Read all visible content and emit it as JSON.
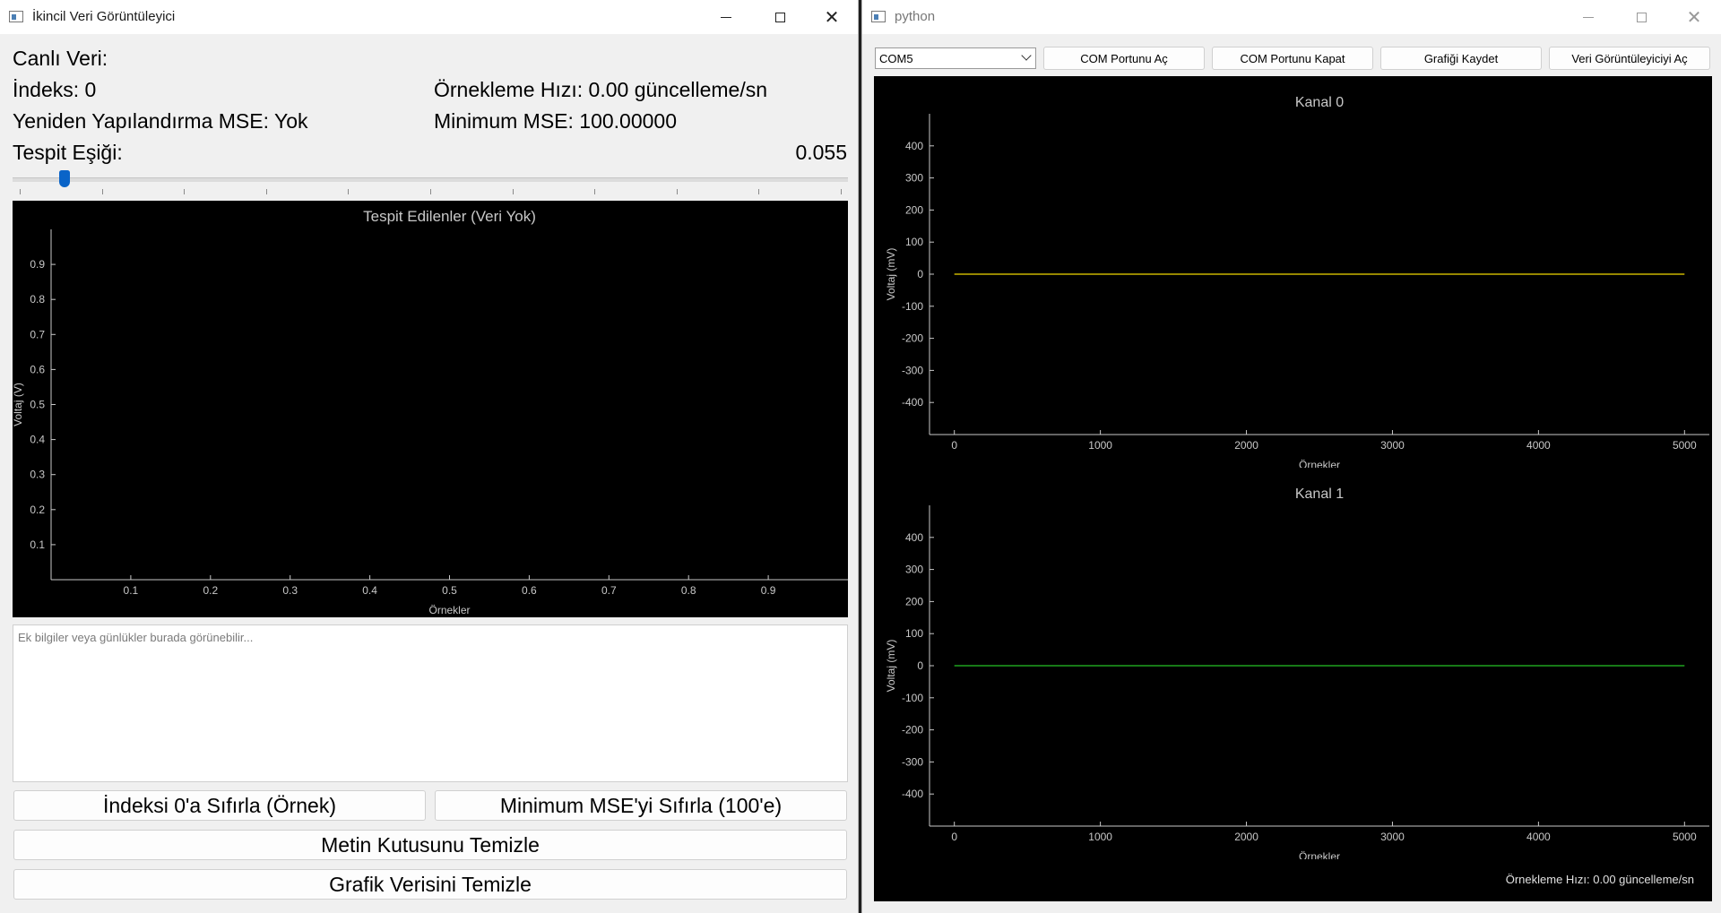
{
  "detection_window": {
    "title": "İkincil Veri Görüntüleyici",
    "live_data_label": "Canlı Veri:",
    "index_label": "İndeks: 0",
    "sampling_rate_label": "Örnekleme Hızı: 0.00 güncelleme/sn",
    "reconstruction_mse_label": "Yeniden Yapılandırma MSE: Yok",
    "minimum_mse_label": "Minimum MSE: 100.00000",
    "threshold_label": "Tespit Eşiği:",
    "threshold_value": "0.055",
    "threshold_slider": {
      "min": 0,
      "max": 1,
      "value": 0.055
    },
    "log_placeholder": "Ek bilgiler veya günlükler burada görünebilir...",
    "buttons": {
      "reset_index": "İndeksi 0'a Sıfırla (Örnek)",
      "reset_min_mse": "Minimum MSE'yi Sıfırla (100'e)",
      "clear_textbox": "Metin Kutusunu Temizle",
      "clear_plot": "Grafik Verisini Temizle"
    }
  },
  "serial_window": {
    "title": "python",
    "port_select": {
      "selected": "COM5"
    },
    "buttons": {
      "open_port": "COM Portunu Aç",
      "close_port": "COM Portunu Kapat",
      "save_plot": "Grafiği Kaydet",
      "open_viewer": "Veri Görüntüleyiciyi Aç"
    },
    "status": "Örnekleme Hızı: 0.00 güncelleme/sn"
  },
  "colors": {
    "plot_bg": "#000000",
    "axis": "#c8c8c8",
    "channel0_line": "#c8b400",
    "channel1_line": "#1fa31f",
    "slider_handle": "#0a64c8"
  },
  "chart_data": [
    {
      "id": "detected",
      "type": "line",
      "title": "Tespit Edilenler (Veri Yok)",
      "xlabel": "Örnekler",
      "ylabel": "Voltaj (V)",
      "xlim": [
        0,
        1
      ],
      "ylim": [
        0,
        1
      ],
      "x_ticks": [
        "0.1",
        "0.2",
        "0.3",
        "0.4",
        "0.5",
        "0.6",
        "0.7",
        "0.8",
        "0.9"
      ],
      "y_ticks": [
        "0.1",
        "0.2",
        "0.3",
        "0.4",
        "0.5",
        "0.6",
        "0.7",
        "0.8",
        "0.9"
      ],
      "series": []
    },
    {
      "id": "kanal0",
      "type": "line",
      "title": "Kanal 0",
      "xlabel": "Örnekler",
      "ylabel": "Voltaj (mV)",
      "xlim": [
        -170,
        5170
      ],
      "ylim": [
        -500,
        500
      ],
      "x_ticks": [
        "0",
        "1000",
        "2000",
        "3000",
        "4000",
        "5000"
      ],
      "y_ticks": [
        "-400",
        "-300",
        "-200",
        "-100",
        "0",
        "100",
        "200",
        "300",
        "400"
      ],
      "series": [
        {
          "color": "#c8b400",
          "x": [
            0,
            5000
          ],
          "y": [
            0,
            0
          ]
        }
      ]
    },
    {
      "id": "kanal1",
      "type": "line",
      "title": "Kanal 1",
      "xlabel": "Örnekler",
      "ylabel": "Voltaj (mV)",
      "xlim": [
        -170,
        5170
      ],
      "ylim": [
        -500,
        500
      ],
      "x_ticks": [
        "0",
        "1000",
        "2000",
        "3000",
        "4000",
        "5000"
      ],
      "y_ticks": [
        "-400",
        "-300",
        "-200",
        "-100",
        "0",
        "100",
        "200",
        "300",
        "400"
      ],
      "series": [
        {
          "color": "#1fa31f",
          "x": [
            0,
            5000
          ],
          "y": [
            0,
            0
          ]
        }
      ]
    }
  ]
}
